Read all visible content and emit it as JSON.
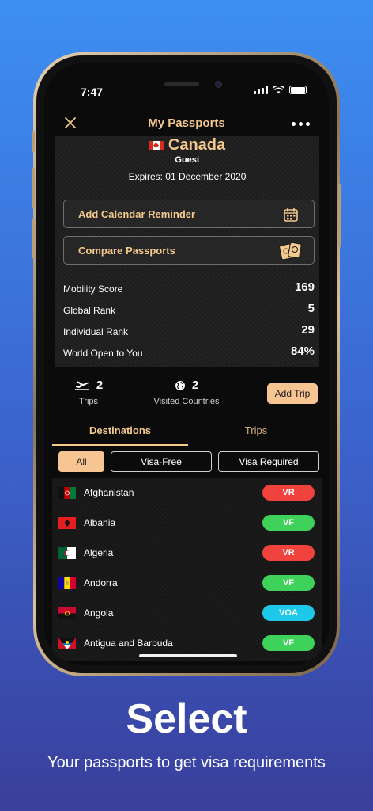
{
  "status_bar": {
    "time": "7:47"
  },
  "nav": {
    "title": "My Passports"
  },
  "passport": {
    "country": "Canada",
    "holder": "Guest",
    "expires": "Expires: 01 December 2020"
  },
  "actions": {
    "calendar_label": "Add Calendar Reminder",
    "compare_label": "Compare Passports"
  },
  "stats": [
    {
      "label": "Mobility Score",
      "value": "169"
    },
    {
      "label": "Global Rank",
      "value": "5"
    },
    {
      "label": "Individual Rank",
      "value": "29"
    },
    {
      "label": "World Open to You",
      "value": "84%"
    }
  ],
  "summary": {
    "trips_count": "2",
    "trips_label": "Trips",
    "visited_count": "2",
    "visited_label": "Visited Countries",
    "add_trip_label": "Add Trip"
  },
  "tabs": [
    {
      "label": "Destinations"
    },
    {
      "label": "Trips"
    }
  ],
  "filters": [
    {
      "label": "All"
    },
    {
      "label": "Visa-Free"
    },
    {
      "label": "Visa Required"
    }
  ],
  "destinations": [
    {
      "name": "Afghanistan",
      "badge": "VR"
    },
    {
      "name": "Albania",
      "badge": "VF"
    },
    {
      "name": "Algeria",
      "badge": "VR"
    },
    {
      "name": "Andorra",
      "badge": "VF"
    },
    {
      "name": "Angola",
      "badge": "VOA"
    },
    {
      "name": "Antigua and Barbuda",
      "badge": "VF"
    }
  ],
  "badge_colors": {
    "VR": "#f0433d",
    "VF": "#3fd25a",
    "VOA": "#1ec8e8"
  },
  "accent_color": "#f3c98e",
  "promo": {
    "headline": "Select",
    "subline": "Your passports to get visa requirements"
  }
}
